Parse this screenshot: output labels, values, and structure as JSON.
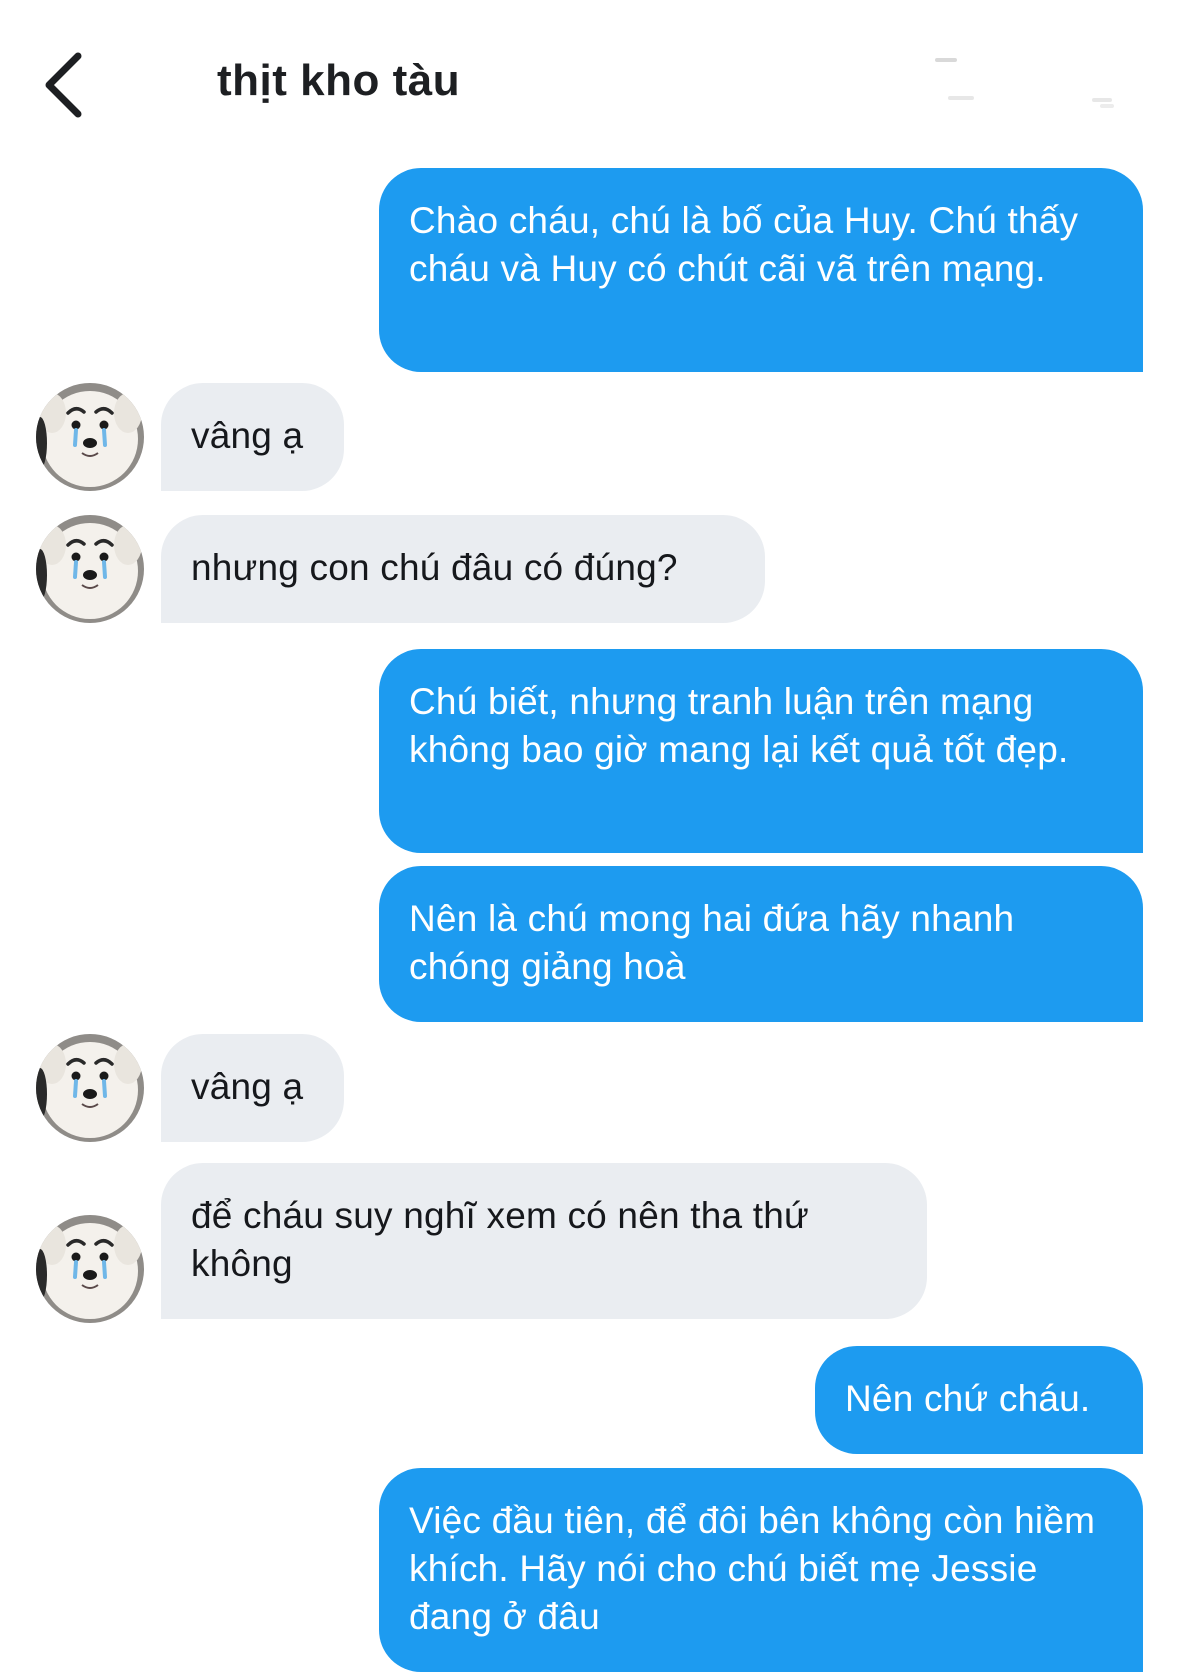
{
  "header": {
    "title": "thịt kho tàu"
  },
  "messages": [
    {
      "direction": "out",
      "text": "Chào cháu, chú là bố của Huy. Chú thấy cháu và Huy có chút cãi vã trên mạng."
    },
    {
      "direction": "in",
      "text": "vâng ạ"
    },
    {
      "direction": "in",
      "text": "nhưng con chú đâu có đúng?"
    },
    {
      "direction": "out",
      "text": "Chú biết, nhưng tranh luận trên mạng không bao giờ mang lại kết quả tốt đẹp."
    },
    {
      "direction": "out",
      "text": "Nên là chú mong hai đứa hãy nhanh chóng giảng hoà"
    },
    {
      "direction": "in",
      "text": "vâng ạ"
    },
    {
      "direction": "in",
      "text": "để cháu suy nghĩ xem có nên tha thứ không"
    },
    {
      "direction": "out",
      "text": "Nên chứ cháu."
    },
    {
      "direction": "out",
      "text": "Việc đầu tiên, để đôi bên không còn hiềm khích. Hãy nói cho chú biết mẹ Jessie đang ở đâu"
    }
  ],
  "colors": {
    "outgoing_bubble": "#1d9bf0",
    "incoming_bubble": "#eaedf1",
    "outgoing_text": "#ffffff",
    "incoming_text": "#16181c"
  },
  "icons": {
    "back": "chevron-left-icon",
    "avatar": "samoyed-dog-avatar"
  }
}
